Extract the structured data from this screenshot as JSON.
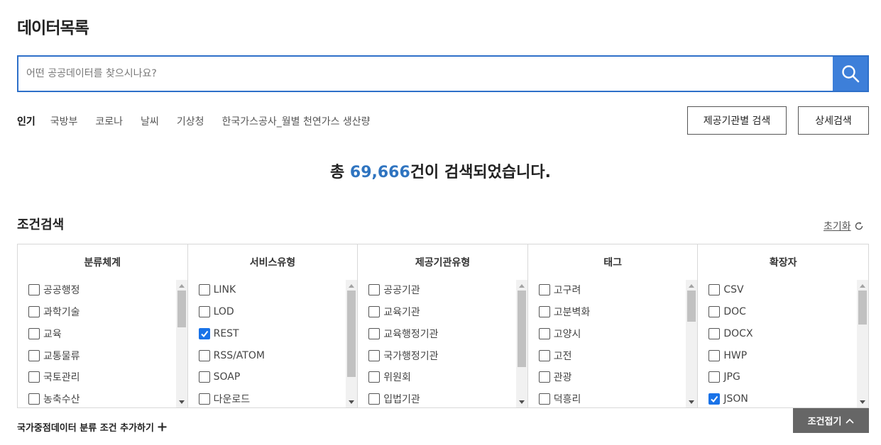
{
  "page": {
    "title": "데이터목록"
  },
  "search": {
    "placeholder": "어떤 공공데이터를 찾으시나요?",
    "value": "",
    "button_icon": "search-icon"
  },
  "popular": {
    "label": "인기",
    "keywords": [
      "국방부",
      "코로나",
      "날씨",
      "기상청",
      "한국가스공사_월별 천연가스 생산량"
    ]
  },
  "buttons": {
    "org_search": "제공기관별 검색",
    "detail_search": "상세검색"
  },
  "result": {
    "prefix": "총 ",
    "count": "69,666",
    "suffix": "건이 검색되었습니다."
  },
  "conditions": {
    "title": "조건검색",
    "reset_label": "초기화",
    "reset_icon": "refresh-icon",
    "columns": [
      {
        "header": "분류체계",
        "items": [
          {
            "label": "공공행정",
            "checked": false
          },
          {
            "label": "과학기술",
            "checked": false
          },
          {
            "label": "교육",
            "checked": false
          },
          {
            "label": "교통물류",
            "checked": false
          },
          {
            "label": "국토관리",
            "checked": false
          },
          {
            "label": "농축수산",
            "checked": false
          }
        ]
      },
      {
        "header": "서비스유형",
        "items": [
          {
            "label": "LINK",
            "checked": false
          },
          {
            "label": "LOD",
            "checked": false
          },
          {
            "label": "REST",
            "checked": true
          },
          {
            "label": "RSS/ATOM",
            "checked": false
          },
          {
            "label": "SOAP",
            "checked": false
          },
          {
            "label": "다운로드",
            "checked": false
          }
        ]
      },
      {
        "header": "제공기관유형",
        "items": [
          {
            "label": "공공기관",
            "checked": false
          },
          {
            "label": "교육기관",
            "checked": false
          },
          {
            "label": "교육행정기관",
            "checked": false
          },
          {
            "label": "국가행정기관",
            "checked": false
          },
          {
            "label": "위원회",
            "checked": false
          },
          {
            "label": "입법기관",
            "checked": false
          }
        ]
      },
      {
        "header": "태그",
        "items": [
          {
            "label": "고구려",
            "checked": false
          },
          {
            "label": "고분벽화",
            "checked": false
          },
          {
            "label": "고양시",
            "checked": false
          },
          {
            "label": "고전",
            "checked": false
          },
          {
            "label": "관광",
            "checked": false
          },
          {
            "label": "덕흥리",
            "checked": false
          }
        ]
      },
      {
        "header": "확장자",
        "items": [
          {
            "label": "CSV",
            "checked": false
          },
          {
            "label": "DOC",
            "checked": false
          },
          {
            "label": "DOCX",
            "checked": false
          },
          {
            "label": "HWP",
            "checked": false
          },
          {
            "label": "JPG",
            "checked": false
          },
          {
            "label": "JSON",
            "checked": true
          }
        ]
      }
    ]
  },
  "national": {
    "label": "국가중점데이터 분류 조건 추가하기",
    "icon": "plus-icon"
  },
  "collapse": {
    "label": "조건접기",
    "icon": "chevron-up-icon"
  },
  "colors": {
    "accent": "#3d7fd9",
    "count": "#2f74c0",
    "checkbox": "#1a73e8",
    "collapse_bg": "#666666"
  }
}
